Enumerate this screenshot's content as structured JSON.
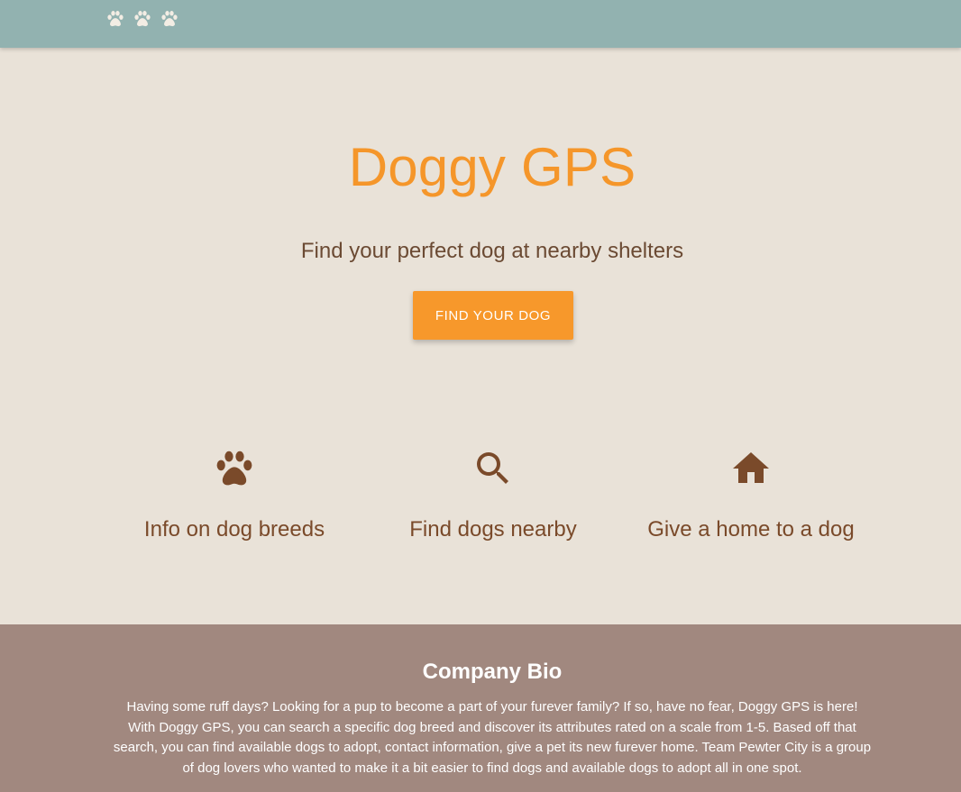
{
  "navbar": {
    "logo_icons": [
      "paw-icon",
      "paw-icon",
      "paw-icon"
    ],
    "background_color": "#92b2b0"
  },
  "hero": {
    "title": "Doggy GPS",
    "subtitle": "Find your perfect dog at nearby shelters",
    "cta_label": "FIND YOUR DOG",
    "accent_color": "#f7982b"
  },
  "features": [
    {
      "icon": "paw-icon",
      "label": "Info on dog breeds"
    },
    {
      "icon": "search-icon",
      "label": "Find dogs nearby"
    },
    {
      "icon": "home-icon",
      "label": "Give a home to a dog"
    }
  ],
  "footer": {
    "title": "Company Bio",
    "bio": "Having some ruff days? Looking for a pup to become a part of your furever family? If so, have no fear, Doggy GPS is here! With Doggy GPS, you can search a specific dog breed and discover its attributes rated on a scale from 1-5. Based off that search, you can find available dogs to adopt, contact information, give a pet its new furever home. Team Pewter City is a group of dog lovers who wanted to make it a bit easier to find dogs and available dogs to adopt all in one spot.",
    "background_color": "#a1887f"
  }
}
